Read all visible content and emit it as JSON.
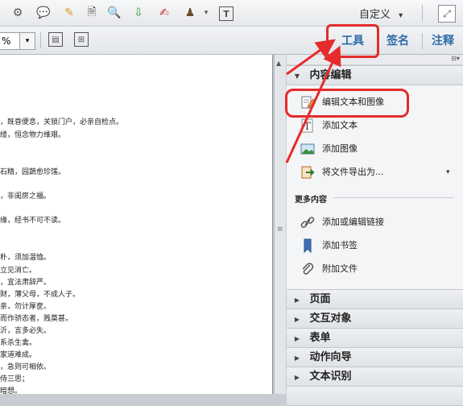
{
  "toolbar": {
    "custom_label": "自定义",
    "custom_caret": "▾"
  },
  "toolbar2": {
    "zoom_value": "%",
    "zoom_caret": "▾"
  },
  "top_buttons": {
    "tools": "工具",
    "sign": "签名",
    "comment": "注释"
  },
  "document": {
    "lines": [
      "，既昏便息，关锁门户，必亲自检点。",
      "缕，恒念物力维艰。",
      "石精，园蔬愈珍馐。",
      "，非闺房之福。",
      "缘，经书不可不读。",
      "朴，须加温恤。",
      "立见消亡。",
      "，宜法肃辞严。",
      "财，薄父母，不成人子。",
      "亲，勿计厚奁。",
      "而作骄态者，贱莫甚。",
      "沂，言多必失。",
      "系杀生禽。",
      "家道难成。",
      "，急则可相依。",
      "侍三思；",
      "暗想。"
    ]
  },
  "panel": {
    "content_editing": "内容编辑",
    "edit_text_image": "编辑文本和图像",
    "add_text": "添加文本",
    "add_image": "添加图像",
    "export_file": "将文件导出为...",
    "more_content": "更多内容",
    "add_edit_link": "添加或编辑链接",
    "add_bookmark": "添加书签",
    "attach_file": "附加文件",
    "page": "页面",
    "interactive_objects": "交互对象",
    "forms": "表单",
    "action_wizard": "动作向导",
    "text_recognition": "文本识别"
  },
  "colors": {
    "accent": "#2d6aa6",
    "callout": "#e52b2b",
    "panel_bg": "#f4f5f7"
  }
}
